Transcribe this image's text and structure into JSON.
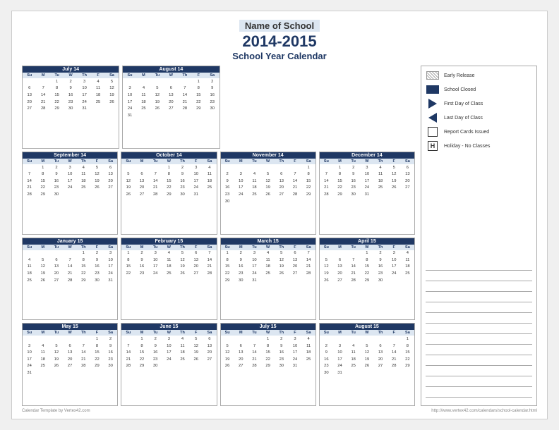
{
  "header": {
    "school_name": "Name of School",
    "year": "2014-2015",
    "subtitle": "School Year Calendar"
  },
  "legend": {
    "items": [
      {
        "id": "early-release",
        "label": "Early Release",
        "icon": "hatch"
      },
      {
        "id": "school-closed",
        "label": "School Closed",
        "icon": "blue"
      },
      {
        "id": "first-day",
        "label": "First Day of Class",
        "icon": "triangle-right"
      },
      {
        "id": "last-day",
        "label": "Last Day of Class",
        "icon": "triangle-left"
      },
      {
        "id": "report-cards",
        "label": "Report Cards Issued",
        "icon": "box"
      },
      {
        "id": "holiday",
        "label": "Holiday - No Classes",
        "icon": "h"
      }
    ]
  },
  "months": [
    {
      "name": "July 14",
      "days_header": [
        "Su",
        "M",
        "Tu",
        "W",
        "Th",
        "F",
        "Sa"
      ],
      "weeks": [
        [
          "",
          "",
          "1",
          "2",
          "3",
          "4",
          "5"
        ],
        [
          "6",
          "7",
          "8",
          "9",
          "10",
          "11",
          "12"
        ],
        [
          "13",
          "14",
          "15",
          "16",
          "17",
          "18",
          "19"
        ],
        [
          "20",
          "21",
          "22",
          "23",
          "24",
          "25",
          "26"
        ],
        [
          "27",
          "28",
          "29",
          "30",
          "31",
          "",
          ""
        ]
      ]
    },
    {
      "name": "August 14",
      "days_header": [
        "Su",
        "M",
        "Tu",
        "W",
        "Th",
        "F",
        "Sa"
      ],
      "weeks": [
        [
          "",
          "",
          "",
          "",
          "",
          "1",
          "2"
        ],
        [
          "3",
          "4",
          "5",
          "6",
          "7",
          "8",
          "9"
        ],
        [
          "10",
          "11",
          "12",
          "13",
          "14",
          "15",
          "16"
        ],
        [
          "17",
          "18",
          "19",
          "20",
          "21",
          "22",
          "23"
        ],
        [
          "24",
          "25",
          "26",
          "27",
          "28",
          "29",
          "30"
        ],
        [
          "31",
          "",
          "",
          "",
          "",
          "",
          ""
        ]
      ]
    },
    {
      "name": "September 14",
      "days_header": [
        "Su",
        "M",
        "Tu",
        "W",
        "Th",
        "F",
        "Sa"
      ],
      "weeks": [
        [
          "",
          "1",
          "2",
          "3",
          "4",
          "5",
          "6"
        ],
        [
          "7",
          "8",
          "9",
          "10",
          "11",
          "12",
          "13"
        ],
        [
          "14",
          "15",
          "16",
          "17",
          "18",
          "19",
          "20"
        ],
        [
          "21",
          "22",
          "23",
          "24",
          "25",
          "26",
          "27"
        ],
        [
          "28",
          "29",
          "30",
          "",
          "",
          "",
          ""
        ]
      ]
    },
    {
      "name": "October 14",
      "days_header": [
        "Su",
        "M",
        "Tu",
        "W",
        "Th",
        "F",
        "Sa"
      ],
      "weeks": [
        [
          "",
          "",
          "",
          "1",
          "2",
          "3",
          "4"
        ],
        [
          "5",
          "6",
          "7",
          "8",
          "9",
          "10",
          "11"
        ],
        [
          "12",
          "13",
          "14",
          "15",
          "16",
          "17",
          "18"
        ],
        [
          "19",
          "20",
          "21",
          "22",
          "23",
          "24",
          "25"
        ],
        [
          "26",
          "27",
          "28",
          "29",
          "30",
          "31",
          ""
        ]
      ]
    },
    {
      "name": "November 14",
      "days_header": [
        "Su",
        "M",
        "Tu",
        "W",
        "Th",
        "F",
        "Sa"
      ],
      "weeks": [
        [
          "",
          "",
          "",
          "",
          "",
          "",
          "1"
        ],
        [
          "2",
          "3",
          "4",
          "5",
          "6",
          "7",
          "8"
        ],
        [
          "9",
          "10",
          "11",
          "12",
          "13",
          "14",
          "15"
        ],
        [
          "16",
          "17",
          "18",
          "19",
          "20",
          "21",
          "22"
        ],
        [
          "23",
          "24",
          "25",
          "26",
          "27",
          "28",
          "29"
        ],
        [
          "30",
          "",
          "",
          "",
          "",
          "",
          ""
        ]
      ]
    },
    {
      "name": "December 14",
      "days_header": [
        "Su",
        "M",
        "Tu",
        "W",
        "Th",
        "F",
        "Sa"
      ],
      "weeks": [
        [
          "",
          "1",
          "2",
          "3",
          "4",
          "5",
          "6"
        ],
        [
          "7",
          "8",
          "9",
          "10",
          "11",
          "12",
          "13"
        ],
        [
          "14",
          "15",
          "16",
          "17",
          "18",
          "19",
          "20"
        ],
        [
          "21",
          "22",
          "23",
          "24",
          "25",
          "26",
          "27"
        ],
        [
          "28",
          "29",
          "30",
          "31",
          "",
          "",
          ""
        ]
      ]
    },
    {
      "name": "January 15",
      "days_header": [
        "Su",
        "M",
        "Tu",
        "W",
        "Th",
        "F",
        "Sa"
      ],
      "weeks": [
        [
          "",
          "",
          "",
          "",
          "1",
          "2",
          "3"
        ],
        [
          "4",
          "5",
          "6",
          "7",
          "8",
          "9",
          "10"
        ],
        [
          "11",
          "12",
          "13",
          "14",
          "15",
          "16",
          "17"
        ],
        [
          "18",
          "19",
          "20",
          "21",
          "22",
          "23",
          "24"
        ],
        [
          "25",
          "26",
          "27",
          "28",
          "29",
          "30",
          "31"
        ]
      ]
    },
    {
      "name": "February 15",
      "days_header": [
        "Su",
        "M",
        "Tu",
        "W",
        "Th",
        "F",
        "Sa"
      ],
      "weeks": [
        [
          "1",
          "2",
          "3",
          "4",
          "5",
          "6",
          "7"
        ],
        [
          "8",
          "9",
          "10",
          "11",
          "12",
          "13",
          "14"
        ],
        [
          "15",
          "16",
          "17",
          "18",
          "19",
          "20",
          "21"
        ],
        [
          "22",
          "23",
          "24",
          "25",
          "26",
          "27",
          "28"
        ]
      ]
    },
    {
      "name": "March 15",
      "days_header": [
        "Su",
        "M",
        "Tu",
        "W",
        "Th",
        "F",
        "Sa"
      ],
      "weeks": [
        [
          "1",
          "2",
          "3",
          "4",
          "5",
          "6",
          "7"
        ],
        [
          "8",
          "9",
          "10",
          "11",
          "12",
          "13",
          "14"
        ],
        [
          "15",
          "16",
          "17",
          "18",
          "19",
          "20",
          "21"
        ],
        [
          "22",
          "23",
          "24",
          "25",
          "26",
          "27",
          "28"
        ],
        [
          "29",
          "30",
          "31",
          "",
          "",
          "",
          ""
        ]
      ]
    },
    {
      "name": "April 15",
      "days_header": [
        "Su",
        "M",
        "Tu",
        "W",
        "Th",
        "F",
        "Sa"
      ],
      "weeks": [
        [
          "",
          "",
          "",
          "1",
          "2",
          "3",
          "4"
        ],
        [
          "5",
          "6",
          "7",
          "8",
          "9",
          "10",
          "11"
        ],
        [
          "12",
          "13",
          "14",
          "15",
          "16",
          "17",
          "18"
        ],
        [
          "19",
          "20",
          "21",
          "22",
          "23",
          "24",
          "25"
        ],
        [
          "26",
          "27",
          "28",
          "29",
          "30",
          "",
          ""
        ]
      ]
    },
    {
      "name": "May 15",
      "days_header": [
        "Su",
        "M",
        "Tu",
        "W",
        "Th",
        "F",
        "Sa"
      ],
      "weeks": [
        [
          "",
          "",
          "",
          "",
          "",
          "1",
          "2"
        ],
        [
          "3",
          "4",
          "5",
          "6",
          "7",
          "8",
          "9"
        ],
        [
          "10",
          "11",
          "12",
          "13",
          "14",
          "15",
          "16"
        ],
        [
          "17",
          "18",
          "19",
          "20",
          "21",
          "22",
          "23"
        ],
        [
          "24",
          "25",
          "26",
          "27",
          "28",
          "29",
          "30"
        ],
        [
          "31",
          "",
          "",
          "",
          "",
          "",
          ""
        ]
      ]
    },
    {
      "name": "June 15",
      "days_header": [
        "Su",
        "M",
        "Tu",
        "W",
        "Th",
        "F",
        "Sa"
      ],
      "weeks": [
        [
          "",
          "1",
          "2",
          "3",
          "4",
          "5",
          "6"
        ],
        [
          "7",
          "8",
          "9",
          "10",
          "11",
          "12",
          "13"
        ],
        [
          "14",
          "15",
          "16",
          "17",
          "18",
          "19",
          "20"
        ],
        [
          "21",
          "22",
          "23",
          "24",
          "25",
          "26",
          "27"
        ],
        [
          "28",
          "29",
          "30",
          "",
          "",
          "",
          ""
        ]
      ]
    },
    {
      "name": "July 15",
      "days_header": [
        "Su",
        "M",
        "Tu",
        "W",
        "Th",
        "F",
        "Sa"
      ],
      "weeks": [
        [
          "",
          "",
          "",
          "1",
          "2",
          "3",
          "4"
        ],
        [
          "5",
          "6",
          "7",
          "8",
          "9",
          "10",
          "11"
        ],
        [
          "12",
          "13",
          "14",
          "15",
          "16",
          "17",
          "18"
        ],
        [
          "19",
          "20",
          "21",
          "22",
          "23",
          "24",
          "25"
        ],
        [
          "26",
          "27",
          "28",
          "29",
          "30",
          "31",
          ""
        ]
      ]
    },
    {
      "name": "August 15",
      "days_header": [
        "Su",
        "M",
        "Tu",
        "W",
        "Th",
        "F",
        "Sa"
      ],
      "weeks": [
        [
          "",
          "",
          "",
          "",
          "",
          "",
          "1"
        ],
        [
          "2",
          "3",
          "4",
          "5",
          "6",
          "7",
          "8"
        ],
        [
          "9",
          "10",
          "11",
          "12",
          "13",
          "14",
          "15"
        ],
        [
          "16",
          "17",
          "18",
          "19",
          "20",
          "21",
          "22"
        ],
        [
          "23",
          "24",
          "25",
          "26",
          "27",
          "28",
          "29"
        ],
        [
          "30",
          "31",
          "",
          "",
          "",
          "",
          ""
        ]
      ]
    }
  ],
  "footer": {
    "left": "Calendar Template by Vertex42.com",
    "right": "http://www.vertex42.com/calendars/school-calendar.html"
  }
}
